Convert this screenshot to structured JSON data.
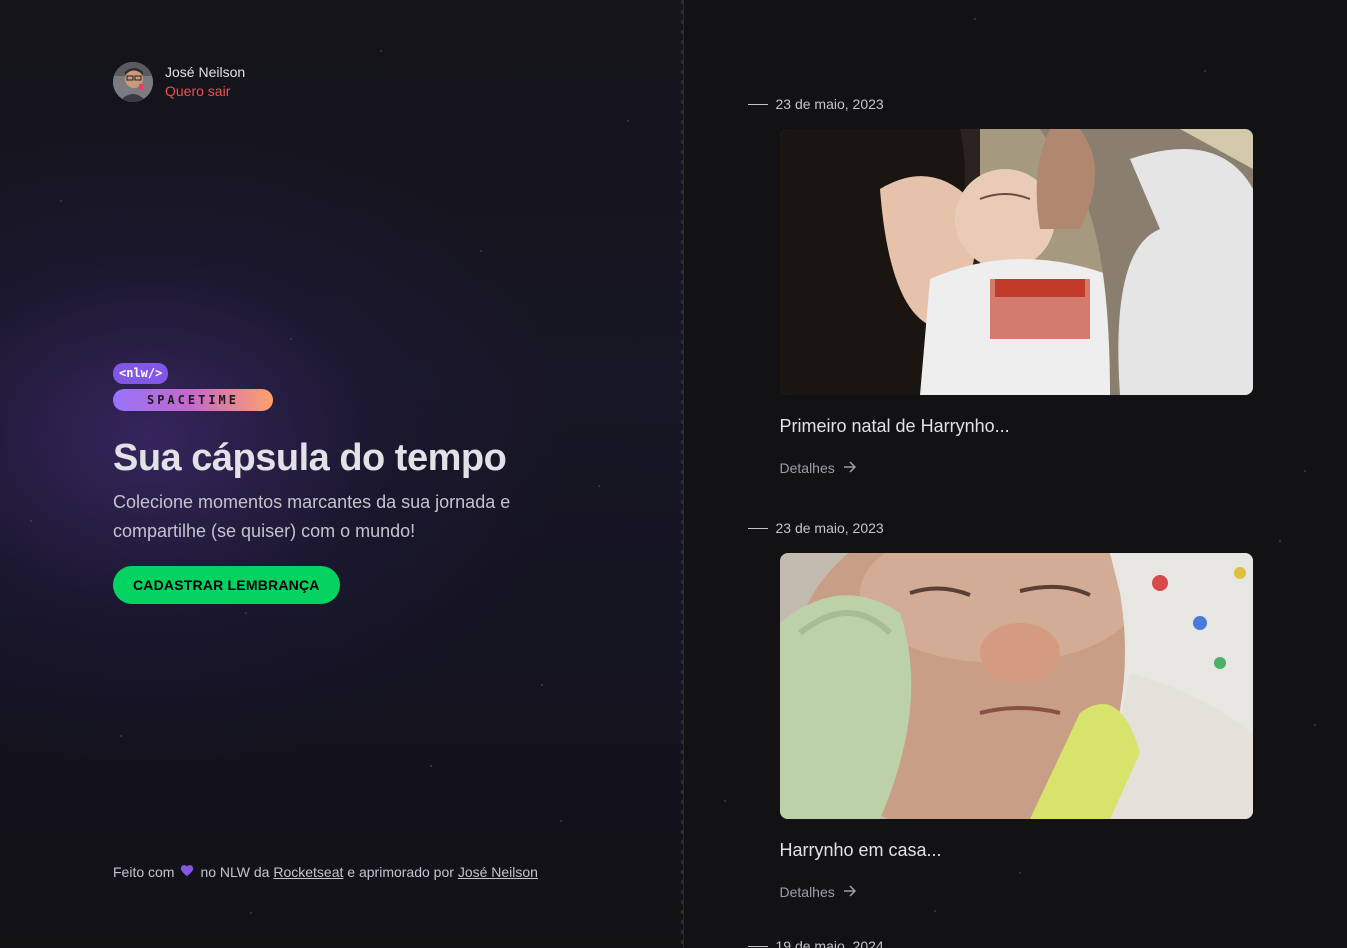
{
  "profile": {
    "name": "José Neilson",
    "logout_label": "Quero sair"
  },
  "logo": {
    "nlw": "<nlw/>",
    "spacetime": "SPACETIME"
  },
  "hero": {
    "title": "Sua cápsula do tempo",
    "text": "Colecione momentos marcantes da sua jornada e compartilhe (se quiser) com o mundo!",
    "cta_label": "CADASTRAR LEMBRANÇA"
  },
  "footer": {
    "prefix": "Feito com",
    "middle": "no NLW da",
    "rocketseat_link": "Rocketseat",
    "suffix": "e aprimorado por",
    "author_link": "José Neilson",
    "heart_icon": "heart-icon"
  },
  "memories": [
    {
      "date": "23 de maio, 2023",
      "excerpt": "Primeiro natal de Harrynho...",
      "link_label": "Detalhes"
    },
    {
      "date": "23 de maio, 2023",
      "excerpt": "Harrynho em casa...",
      "link_label": "Detalhes"
    },
    {
      "date": "19 de maio, 2024"
    }
  ],
  "colors": {
    "accent_green": "#04D361",
    "accent_purple": "#8257E5",
    "logout_red": "#EF5050",
    "background": "#121215"
  }
}
